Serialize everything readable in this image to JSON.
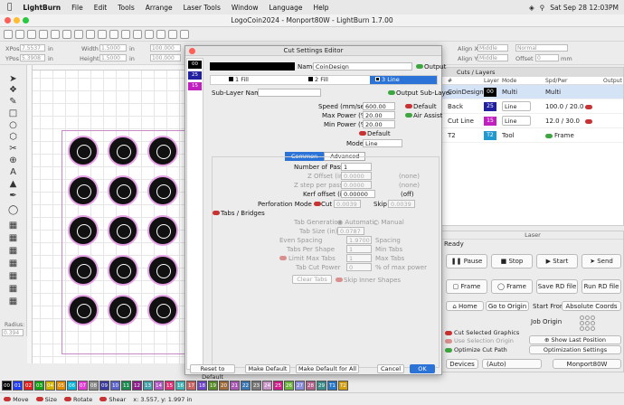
{
  "menubar": {
    "app": "LightBurn",
    "items": [
      "File",
      "Edit",
      "Tools",
      "Arrange",
      "Laser Tools",
      "Window",
      "Language",
      "Help"
    ],
    "datetime": "Sat Sep 28  12:03PM"
  },
  "window": {
    "title": "LogoCoin2024 - Monport80W - LightBurn 1.7.00"
  },
  "coords": {
    "xpos_label": "XPos",
    "xpos": "7.5537",
    "ypos_label": "YPos",
    "ypos": "5.3908",
    "unit": "in",
    "width_label": "Width",
    "width": "1.5000",
    "height_label": "Height",
    "height": "1.5000",
    "pct": "100.000",
    "alignx_label": "Align X",
    "alignx": "Middle",
    "aligny_label": "Align Y",
    "aligny": "Middle",
    "normal": "Normal",
    "offset_label": "Offset",
    "offset": "0",
    "mm": "mm"
  },
  "lefttools": {
    "radius_label": "Radius:",
    "radius": "0.394"
  },
  "palette": [
    "00",
    "01",
    "02",
    "03",
    "04",
    "05",
    "06",
    "07",
    "08",
    "09",
    "10",
    "11",
    "12",
    "13",
    "14",
    "15",
    "16",
    "17",
    "18",
    "19",
    "20",
    "21",
    "22",
    "23",
    "24",
    "25",
    "26",
    "27",
    "28",
    "29",
    "T1",
    "T2"
  ],
  "palette_colors": [
    "#000000",
    "#1f3cff",
    "#e02020",
    "#13a013",
    "#d2b400",
    "#e08c00",
    "#0ab4d6",
    "#e63cd6",
    "#8c8c8c",
    "#3c3ca0",
    "#5a64c8",
    "#1e8c50",
    "#8c1e8c",
    "#46a0aa",
    "#b45ac8",
    "#dc3278",
    "#46b4b4",
    "#c86464",
    "#6e46c8",
    "#5a8c2a",
    "#a06e3c",
    "#aa5ab4",
    "#3c78b4",
    "#7a7a7a",
    "#c896c8",
    "#d21e8c",
    "#6cb43c",
    "#8c8cdc",
    "#b4648c",
    "#3c8c8c",
    "#2878c8",
    "#d2a014"
  ],
  "status": {
    "move": "Move",
    "size": "Size",
    "rotate": "Rotate",
    "shear": "Shear",
    "coord": "x: 3.557, y: 1.997 in"
  },
  "cuts": {
    "title": "Cuts / Layers",
    "headers": [
      "#",
      "Layer",
      "Mode",
      "Spd/Pwr",
      "Output"
    ],
    "rows": [
      {
        "name": "CoinDesign",
        "num": "00",
        "color": "#000000",
        "mode": "Multi",
        "spd": "Multi"
      },
      {
        "name": "Back",
        "num": "25",
        "color": "#2020a0",
        "mode": "Line",
        "spd": "100.0 / 20.0"
      },
      {
        "name": "Cut Line",
        "num": "15",
        "color": "#c020c0",
        "mode": "Line",
        "spd": "12.0 / 30.0"
      },
      {
        "name": "T2",
        "num": "T2",
        "color": "#2098d0",
        "mode": "Tool",
        "spd": "Frame"
      }
    ]
  },
  "laser": {
    "title": "Laser",
    "ready": "Ready",
    "pause": "Pause",
    "stop": "Stop",
    "start": "Start",
    "send": "Send",
    "frame1": "Frame",
    "frame2": "Frame",
    "save_rd": "Save RD file",
    "run_rd": "Run RD file",
    "home": "Home",
    "go_origin": "Go to Origin",
    "start_from_label": "Start From:",
    "start_from": "Absolute Coords",
    "job_origin": "Job Origin",
    "cut_selected": "Cut Selected Graphics",
    "use_selection": "Use Selection Origin",
    "show_last": "Show Last Position",
    "optimize": "Optimize Cut Path",
    "opt_settings": "Optimization Settings",
    "devices": "Devices",
    "auto": "(Auto)",
    "device": "Monport80W"
  },
  "dialog": {
    "title": "Cut Settings Editor",
    "name_label": "Name",
    "name": "CoinDesign",
    "output": "Output",
    "sub_tabs": [
      "1 Fill",
      "2 Fill",
      "3 Line"
    ],
    "sublayer_label": "Sub-Layer Name",
    "output_sublayer": "Output Sub-Layer",
    "speed_label": "Speed (mm/sec)",
    "speed": "600.00",
    "default": "Default",
    "maxpow_label": "Max Power (%)",
    "maxpow": "20.00",
    "air_assist": "Air Assist",
    "minpow_label": "Min Power (%)",
    "minpow": "20.00",
    "default2": "Default",
    "mode_label": "Mode",
    "mode": "Line",
    "tab_common": "Common",
    "tab_advanced": "Advanced",
    "passes_label": "Number of Passes",
    "passes": "1",
    "zoffset_label": "Z Offset (in)",
    "zoffset": "0.0000",
    "none1": "(none)",
    "zstep_label": "Z step per pass (in)",
    "zstep": "0.0000",
    "none2": "(none)",
    "kerf_label": "Kerf offset (in)",
    "kerf": "0.00000",
    "off": "(off)",
    "perf_label": "Perforation Mode",
    "cut_label": "Cut",
    "cut": "0.0039",
    "skip_label": "Skip",
    "skip": "0.0039",
    "tabs_bridges": "Tabs / Bridges",
    "tabgen_label": "Tab Generation",
    "automatic": "Automatic",
    "manual": "Manual",
    "tabsize_label": "Tab Size (in)",
    "tabsize": "0.0787",
    "evensp_label": "Even Spacing",
    "evensp": "1.9700",
    "spacing": "Spacing",
    "tps_label": "Tabs Per Shape",
    "tps": "1",
    "mintabs": "Min Tabs",
    "limitmax_label": "Limit Max Tabs",
    "limitmax": "1",
    "maxtabs": "Max Tabs",
    "tcp_label": "Tab Cut Power",
    "tcp": "0",
    "pct_max": "% of max power",
    "clear_tabs": "Clear Tabs",
    "skip_inner": "Skip Inner Shapes",
    "reset": "Reset to Default",
    "make_default": "Make Default",
    "make_default_all": "Make Default for All",
    "cancel": "Cancel",
    "ok": "OK",
    "layers": [
      {
        "num": "00",
        "color": "#000000"
      },
      {
        "num": "25",
        "color": "#2020a0"
      },
      {
        "num": "15",
        "color": "#c020c0"
      }
    ]
  }
}
